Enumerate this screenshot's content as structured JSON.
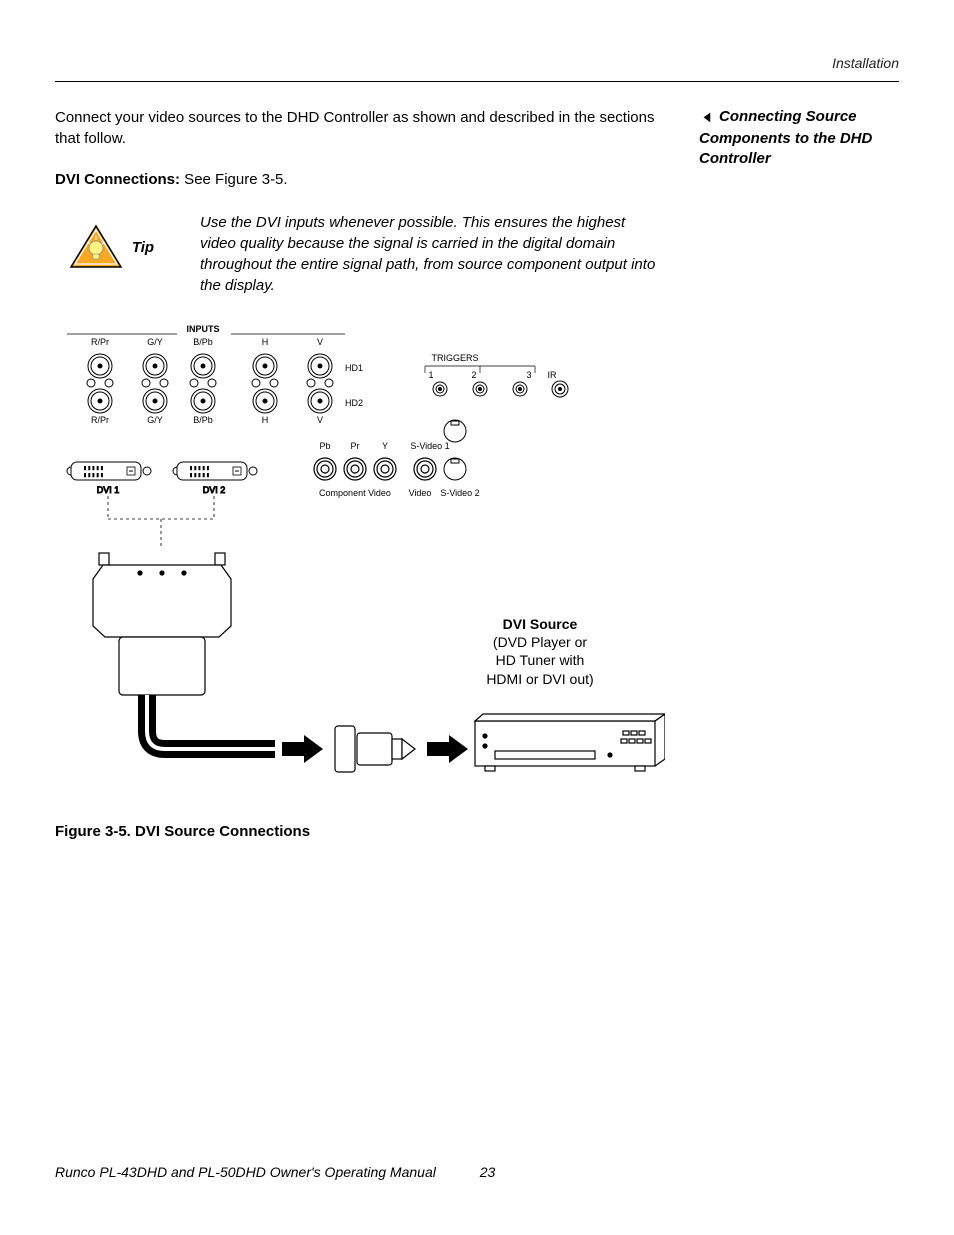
{
  "header": {
    "section": "Installation"
  },
  "side": {
    "arrow": "◄",
    "heading": "Connecting Source Components to the DHD Controller"
  },
  "intro": "Connect your video sources to the DHD Controller as shown and described in the sections that follow.",
  "subhead": {
    "bold": "DVI Connections:",
    "rest": " See Figure 3-5."
  },
  "tip": {
    "label": "Tip",
    "text": "Use the DVI inputs whenever possible. This ensures the highest video quality because the signal is carried in the digital domain throughout the entire signal path, from source component output into the display."
  },
  "diagram": {
    "inputs_title": "INPUTS",
    "top_row_labels": [
      "R/Pr",
      "G/Y",
      "B/Pb",
      "H",
      "V"
    ],
    "hd_labels": [
      "HD1",
      "HD2"
    ],
    "triggers_title": "TRIGGERS",
    "trigger_nums": [
      "1",
      "2",
      "3"
    ],
    "ir_label": "IR",
    "dvi_ports": [
      "DVI 1",
      "DVI 2"
    ],
    "mid_labels": [
      "Pb",
      "Pr",
      "Y",
      "S-Video 1"
    ],
    "bottom_labels": [
      "Component Video",
      "Video",
      "S-Video 2"
    ],
    "dvi_source_bold": "DVI Source",
    "dvi_source_lines": [
      "(DVD Player or",
      "HD Tuner with",
      "HDMI or DVI out)"
    ]
  },
  "figure_caption": "Figure 3-5. DVI Source Connections",
  "footer": {
    "manual": "Runco PL-43DHD and PL-50DHD Owner's Operating Manual",
    "page": "23"
  }
}
